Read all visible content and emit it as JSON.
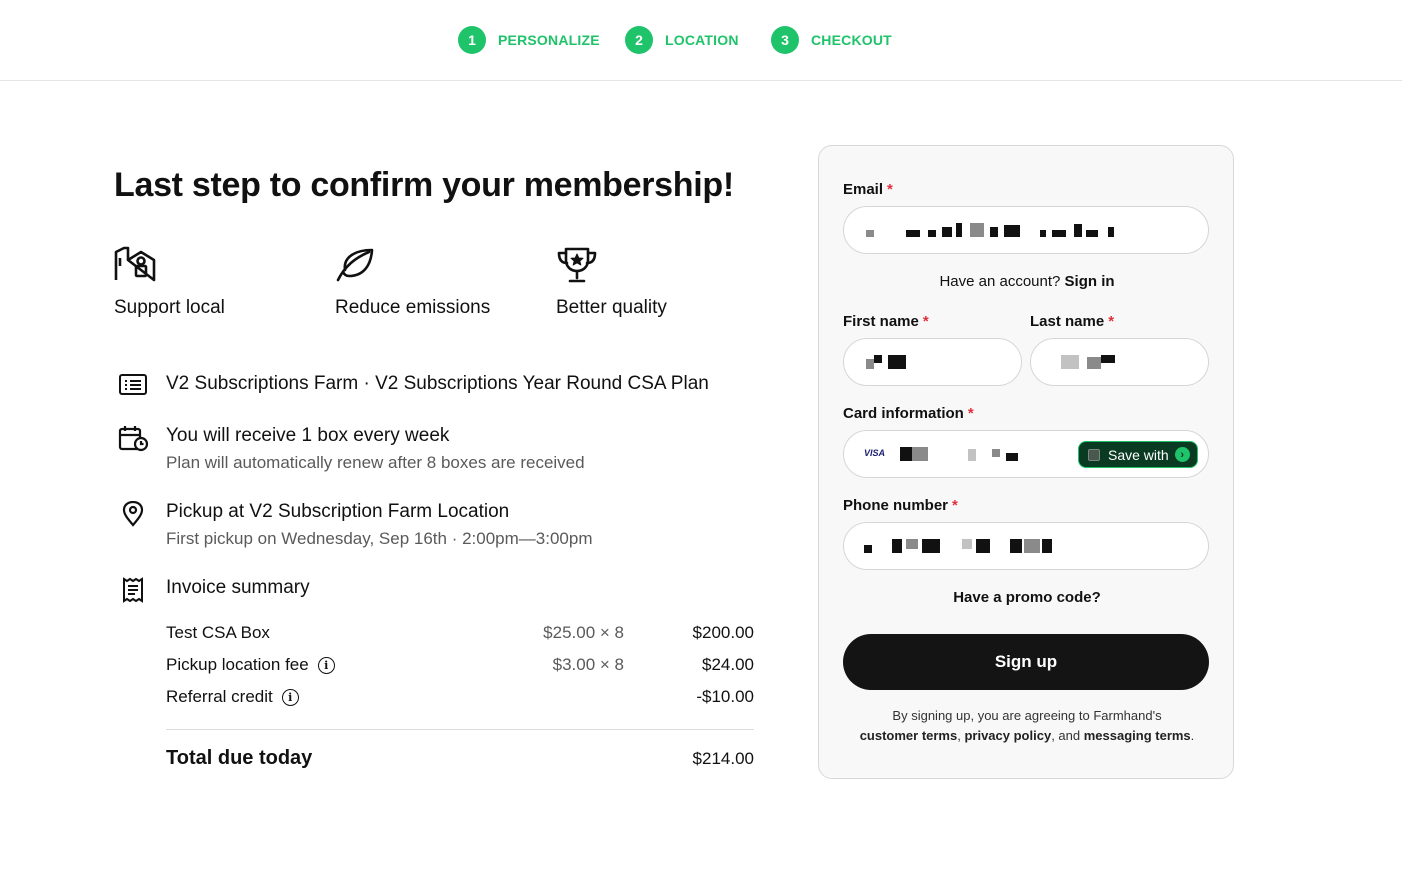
{
  "stepper": [
    {
      "num": "1",
      "label": "PERSONALIZE"
    },
    {
      "num": "2",
      "label": "LOCATION"
    },
    {
      "num": "3",
      "label": "CHECKOUT"
    }
  ],
  "main": {
    "title": "Last step to confirm your membership!",
    "benefits": [
      {
        "icon": "shop-icon",
        "label": "Support local"
      },
      {
        "icon": "leaf-icon",
        "label": "Reduce emissions"
      },
      {
        "icon": "trophy-icon",
        "label": "Better quality"
      }
    ],
    "plan": {
      "title": "V2 Subscriptions Farm · V2 Subscriptions Year Round CSA Plan"
    },
    "schedule": {
      "title": "You will receive 1 box every week",
      "subtitle": "Plan will automatically renew after 8 boxes are received"
    },
    "pickup": {
      "title": "Pickup at V2 Subscription Farm Location",
      "subtitle": "First pickup on Wednesday, Sep 16th · 2:00pm—3:00pm"
    },
    "invoice": {
      "title": "Invoice summary",
      "rows": [
        {
          "name": "Test CSA Box",
          "qty": "$25.00 × 8",
          "total": "$200.00",
          "info": false
        },
        {
          "name": "Pickup location fee",
          "qty": "$3.00 × 8",
          "total": "$24.00",
          "info": true
        },
        {
          "name": "Referral credit",
          "qty": "",
          "total": "-$10.00",
          "info": true
        }
      ],
      "total_label": "Total due today",
      "total_value": "$214.00"
    }
  },
  "form": {
    "email_label": "Email",
    "have_account": "Have an account?",
    "sign_in": "Sign in",
    "first_name_label": "First name",
    "last_name_label": "Last name",
    "card_label": "Card information",
    "card_brand": "VISA",
    "save_with": "Save with",
    "phone_label": "Phone number",
    "promo": "Have a promo code?",
    "signup_button": "Sign up",
    "legal_intro": "By signing up, you are agreeing to Farmhand's",
    "legal_customer_terms": "customer terms",
    "legal_privacy": "privacy policy",
    "legal_and": ", and",
    "legal_messaging": "messaging terms",
    "required_mark": "*"
  },
  "colors": {
    "accent": "#1fc36a",
    "dark": "#141414",
    "required": "#e0303a"
  }
}
